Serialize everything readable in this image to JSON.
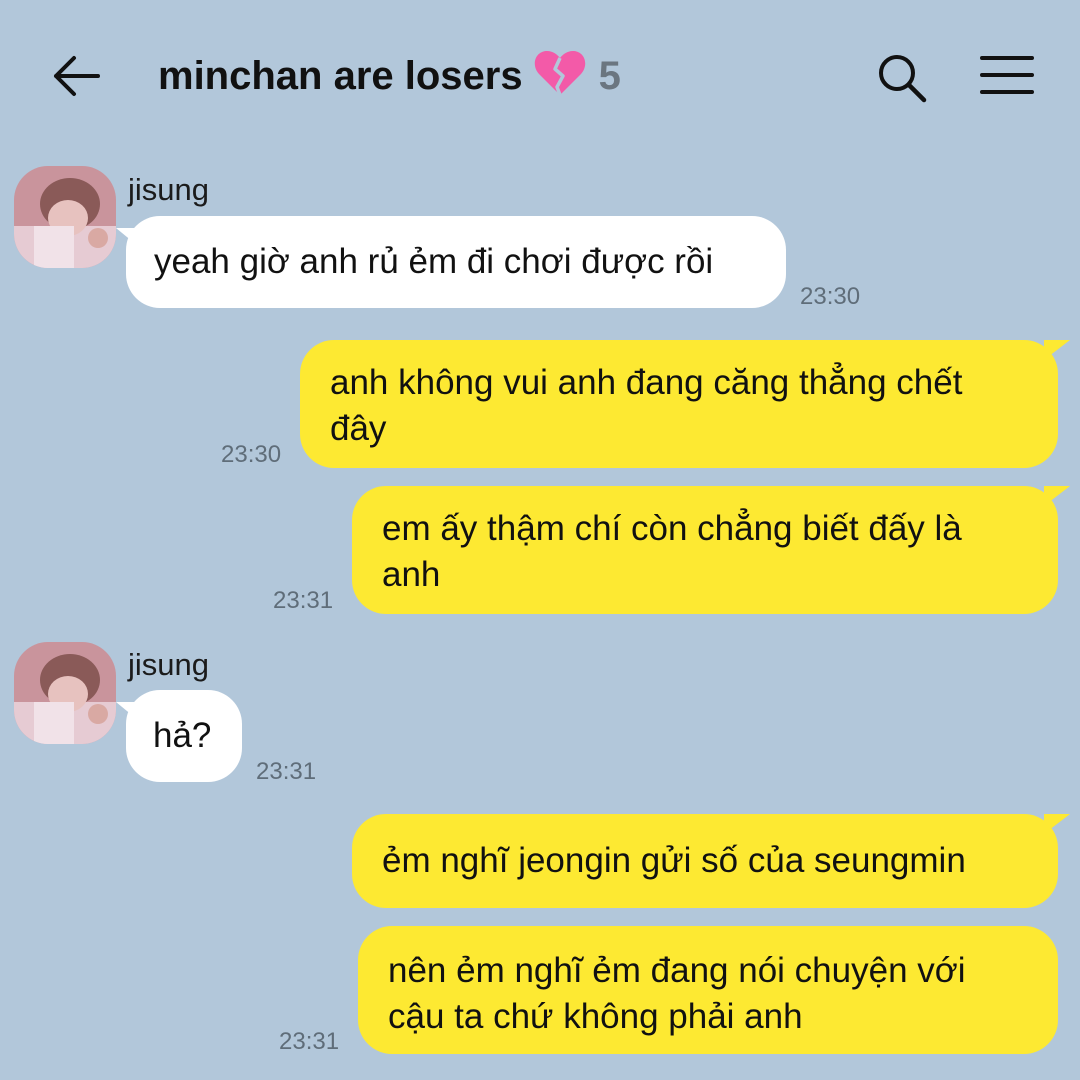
{
  "header": {
    "title": "minchan are losers",
    "title_emoji": "broken-heart-icon",
    "member_count": "5"
  },
  "messages": [
    {
      "sender": "jisung",
      "text": "yeah giờ anh rủ ẻm đi chơi được rồi",
      "time": "23:30",
      "direction": "incoming"
    },
    {
      "text_line1": "anh không vui anh đang căng thẳng chết",
      "text_line2": "đây",
      "time": "23:30",
      "direction": "outgoing"
    },
    {
      "text_line1": "em ấy thậm chí còn chẳng biết đấy là",
      "text_line2": "anh",
      "time": "23:31",
      "direction": "outgoing"
    },
    {
      "sender": "jisung",
      "text": "hả?",
      "time": "23:31",
      "direction": "incoming"
    },
    {
      "text": "ẻm nghĩ jeongin gửi số của seungmin",
      "direction": "outgoing"
    },
    {
      "text_line1": "nên ẻm nghĩ ẻm đang nói chuyện với",
      "text_line2": "cậu ta chứ không phải anh",
      "time": "23:31",
      "direction": "outgoing"
    }
  ],
  "colors": {
    "background": "#b2c7da",
    "incoming_bubble": "#ffffff",
    "outgoing_bubble": "#fde932",
    "timestamp": "#5f6d79"
  }
}
